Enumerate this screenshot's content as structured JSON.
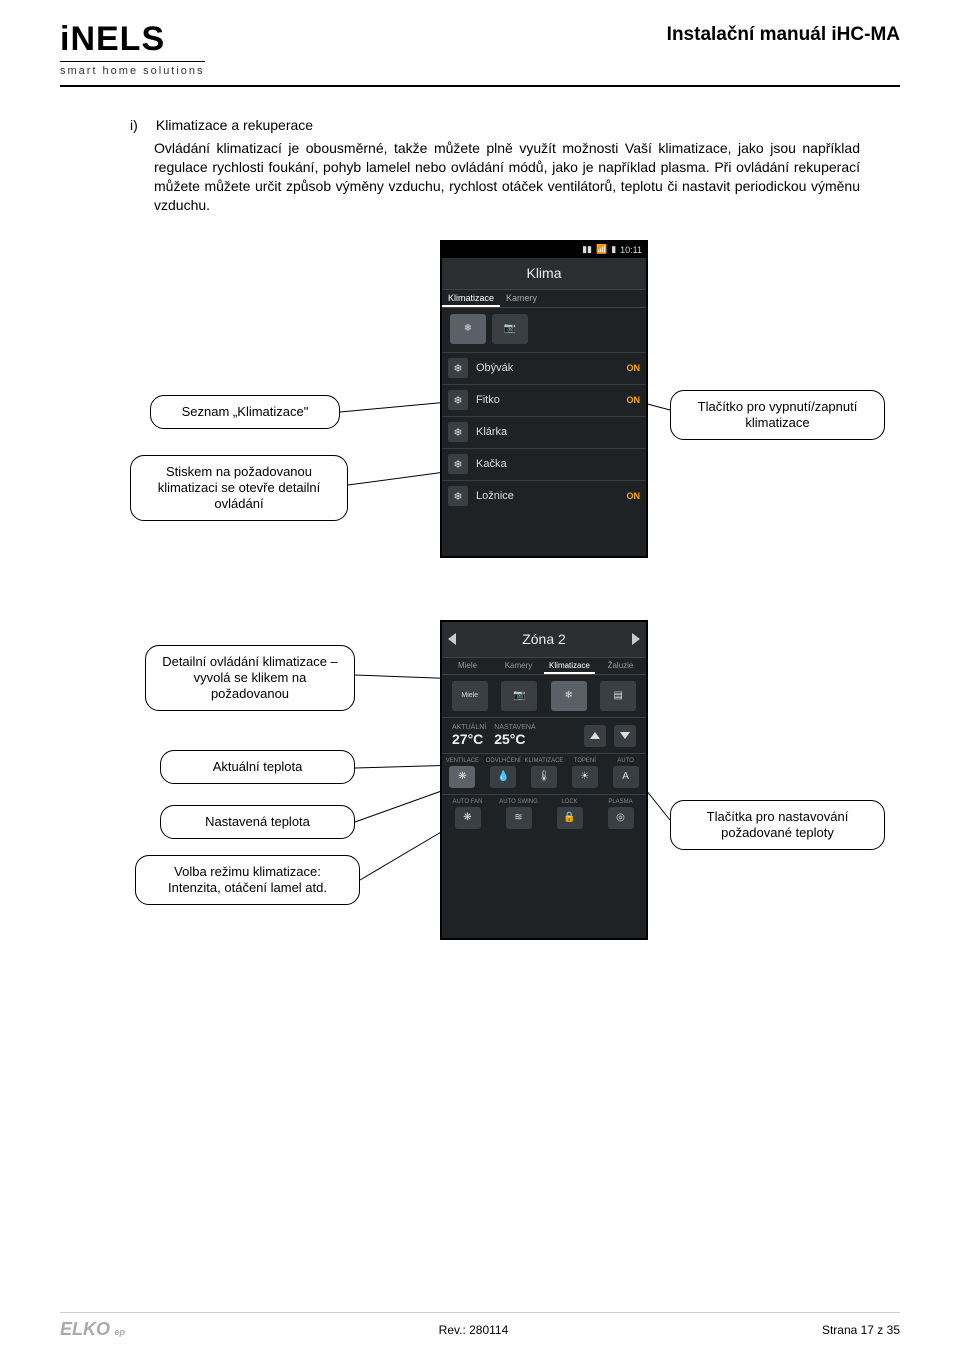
{
  "header": {
    "logo_main": "iNELS",
    "logo_sub": "smart home solutions",
    "doc_title": "Instalační manuál iHC-MA"
  },
  "section": {
    "bullet": "i)",
    "title": "Klimatizace a rekuperace",
    "paragraph": "Ovládání klimatizací je obousměrné, takže můžete plně využít možnosti Vaší klimatizace, jako jsou například regulace rychlosti foukání, pohyb lamelel nebo ovládání módů, jako je například plasma. Při ovládání rekuperací můžete můžete určit způsob výměny vzduchu, rychlost otáček ventilátorů, teplotu či nastavit periodickou výměnu vzduchu."
  },
  "callouts": {
    "seznam": "Seznam „Klimatizace\"",
    "tlacitko_onoff": "Tlačítko pro vypnutí/zapnutí klimatizace",
    "stiskem": "Stiskem na požadovanou klimatizaci se otevře detailní ovládání",
    "detail": "Detailní ovládání klimatizace – vyvolá se klikem na požadovanou",
    "aktualni": "Aktuální teplota",
    "nastavena": "Nastavená teplota",
    "volba": "Volba režimu klimatizace: Intenzita, otáčení lamel atd.",
    "tlacitka_nast": "Tlačítka pro nastavování požadované teploty"
  },
  "phone1": {
    "time": "10:11",
    "screen_title": "Klima",
    "tabs": [
      "Klimatizace",
      "Kamery"
    ],
    "rows": [
      {
        "label": "Obývák",
        "state": "ON"
      },
      {
        "label": "Fitko",
        "state": "ON"
      },
      {
        "label": "Klárka",
        "state": ""
      },
      {
        "label": "Kačka",
        "state": ""
      },
      {
        "label": "Ložnice",
        "state": "ON"
      }
    ]
  },
  "phone2": {
    "zone": "Zóna 2",
    "subtabs": [
      "Miele",
      "Kamery",
      "Klimatizace",
      "Žaluzie"
    ],
    "actual_label": "AKTUÁLNÍ",
    "actual_value": "27°C",
    "set_label": "NASTAVENÁ",
    "set_value": "25°C",
    "modes1": [
      {
        "lbl": "VENTILACE",
        "glyph": "❋"
      },
      {
        "lbl": "ODVLHČENÍ",
        "glyph": "💧"
      },
      {
        "lbl": "KLIMATIZACE",
        "glyph": "🌡"
      },
      {
        "lbl": "TOPENÍ",
        "glyph": "☀"
      },
      {
        "lbl": "AUTO",
        "glyph": "A"
      }
    ],
    "modes2": [
      {
        "lbl": "AUTO FAN",
        "glyph": "❋"
      },
      {
        "lbl": "AUTO SWING",
        "glyph": "≋"
      },
      {
        "lbl": "LOCK",
        "glyph": "🔒"
      },
      {
        "lbl": "PLASMA",
        "glyph": "◎"
      }
    ]
  },
  "footer": {
    "logo": "ELKO",
    "logo_sub": "ep",
    "rev": "Rev.: 280114",
    "page": "Strana 17 z 35"
  }
}
